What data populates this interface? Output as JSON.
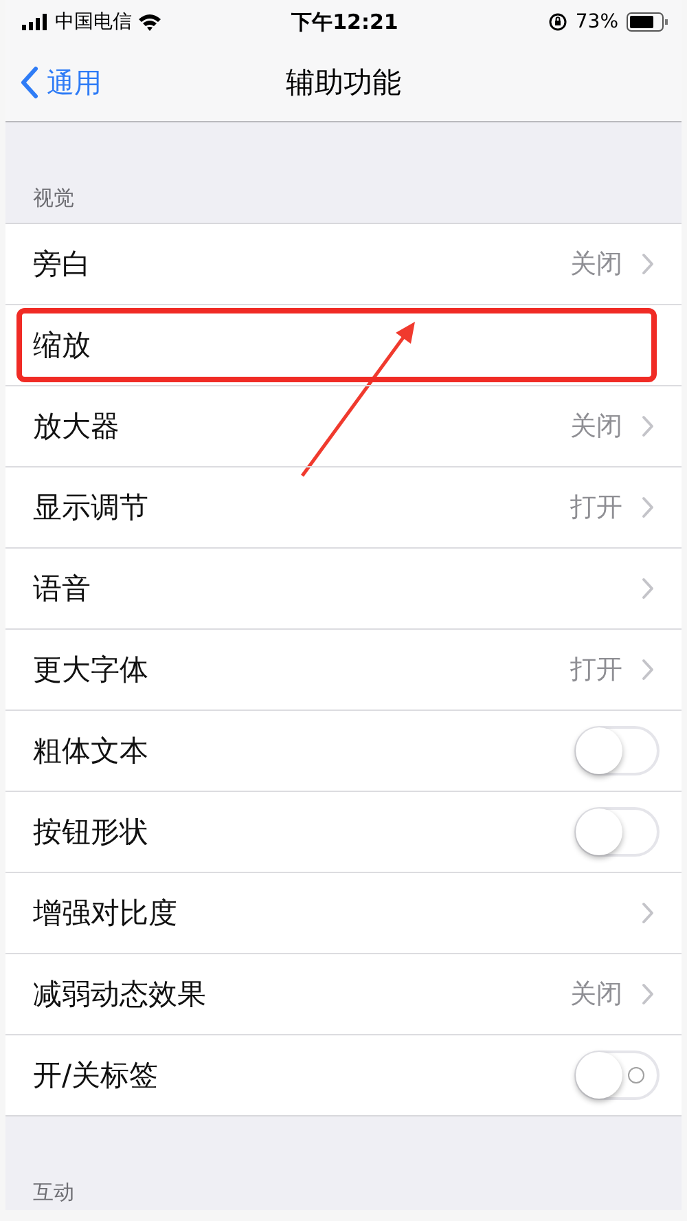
{
  "status_bar": {
    "carrier": "中国电信",
    "time": "下午12:21",
    "battery": "73%"
  },
  "nav": {
    "back": "通用",
    "title": "辅助功能"
  },
  "sections": [
    {
      "header": "视觉",
      "rows": [
        {
          "label": "旁白",
          "kind": "link",
          "value": "关闭"
        },
        {
          "label": "缩放",
          "kind": "plain",
          "highlighted": true
        },
        {
          "label": "放大器",
          "kind": "link",
          "value": "关闭"
        },
        {
          "label": "显示调节",
          "kind": "link",
          "value": "打开"
        },
        {
          "label": "语音",
          "kind": "link"
        },
        {
          "label": "更大字体",
          "kind": "link",
          "value": "打开"
        },
        {
          "label": "粗体文本",
          "kind": "toggle",
          "on": false
        },
        {
          "label": "按钮形状",
          "kind": "toggle",
          "on": false
        },
        {
          "label": "增强对比度",
          "kind": "link"
        },
        {
          "label": "减弱动态效果",
          "kind": "link",
          "value": "关闭"
        },
        {
          "label": "开/关标签",
          "kind": "toggle",
          "on": false,
          "show_label": true
        }
      ]
    },
    {
      "header": "互动"
    }
  ]
}
